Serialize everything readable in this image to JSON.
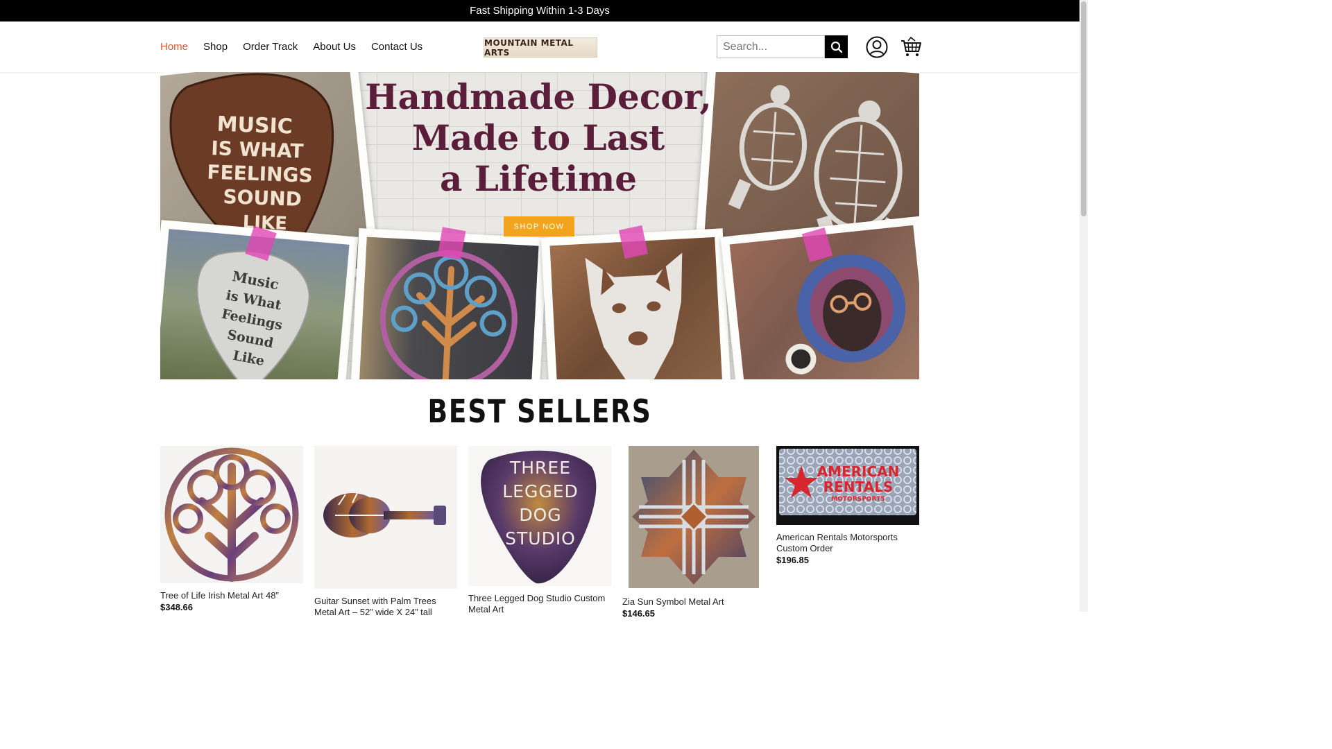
{
  "announcement": "Fast Shipping Within 1-3 Days",
  "nav": {
    "items": [
      {
        "label": "Home",
        "active": true
      },
      {
        "label": "Shop",
        "active": false
      },
      {
        "label": "Order Track",
        "active": false
      },
      {
        "label": "About Us",
        "active": false
      },
      {
        "label": "Contact Us",
        "active": false
      }
    ]
  },
  "logo_text": "MOUNTAIN METAL ARTS",
  "search": {
    "placeholder": "Search..."
  },
  "hero": {
    "title_line1": "Handmade Decor,",
    "title_line2": "Made to Last",
    "title_line3": "a Lifetime",
    "cta": "SHOP NOW",
    "photo_texts": {
      "big_pick": "MUSIC IS WHAT FEELINGS SOUND LIKE",
      "small_pick": "Music is What Feelings Sound Like"
    }
  },
  "best_sellers": {
    "heading": "BEST SELLERS",
    "products": [
      {
        "name_line1": "Tree of Life Irish Metal Art 48”",
        "name_line2": "",
        "price": "$348.66"
      },
      {
        "name_line1": "Guitar Sunset with Palm Trees",
        "name_line2": "Metal Art – 52” wide X 24” tall",
        "price": ""
      },
      {
        "name_line1": "Three Legged Dog Studio Custom",
        "name_line2": "Metal Art",
        "price": "",
        "image_text": [
          "THREE",
          "LEGGED",
          "DOG",
          "STUDIO"
        ]
      },
      {
        "name_line1": "Zia Sun Symbol Metal Art",
        "name_line2": "",
        "price": "$146.65"
      },
      {
        "name_line1": "American Rentals Motorsports",
        "name_line2": "Custom Order",
        "price": "$196.85",
        "image_text": [
          "AMERICAN",
          "RENTALS",
          "MOTORSPORTS"
        ]
      }
    ]
  },
  "colors": {
    "accent": "#e0552c",
    "hero_title": "#5b1e3a",
    "cta": "#f2a41c",
    "tape": "#e048b4"
  }
}
